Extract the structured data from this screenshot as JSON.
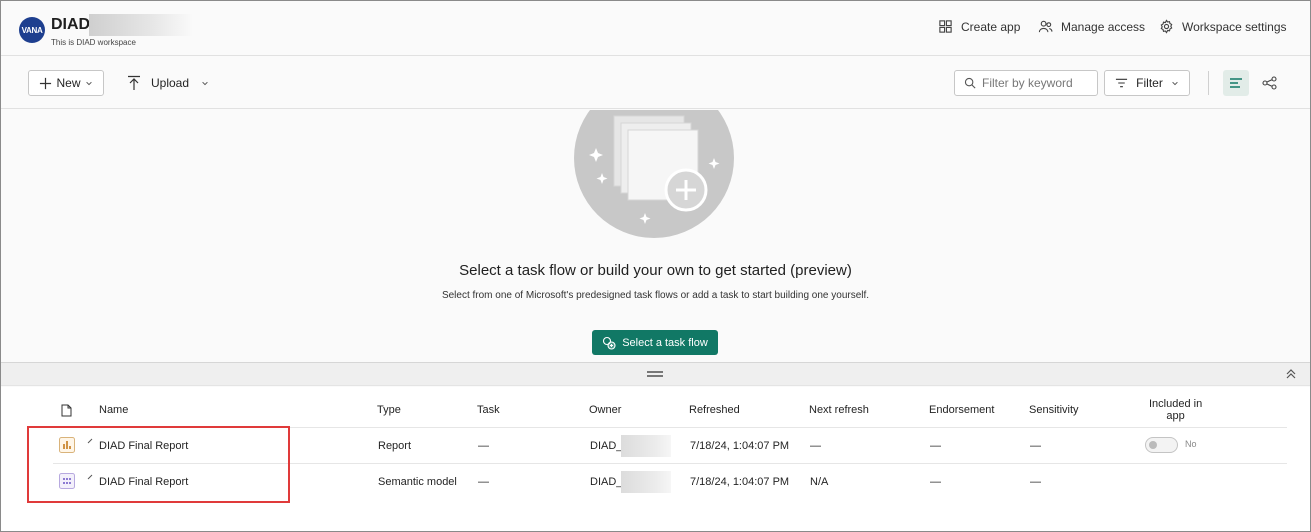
{
  "workspace": {
    "logo_text": "VANA",
    "name": "DIAD_",
    "description": "This is DIAD workspace"
  },
  "header_actions": {
    "create_app": "Create app",
    "manage_access": "Manage access",
    "workspace_settings": "Workspace settings"
  },
  "toolbar": {
    "new_label": "New",
    "upload_label": "Upload",
    "filter_placeholder": "Filter by keyword",
    "filter_label": "Filter"
  },
  "empty_state": {
    "title": "Select a task flow or build your own to get started (preview)",
    "subtitle": "Select from one of Microsoft's predesigned task flows or add a task to start building one yourself.",
    "button_label": "Select a task flow"
  },
  "table": {
    "columns": {
      "name": "Name",
      "type": "Type",
      "task": "Task",
      "owner": "Owner",
      "refreshed": "Refreshed",
      "next_refresh": "Next refresh",
      "endorsement": "Endorsement",
      "sensitivity": "Sensitivity",
      "included_in_app_line1": "Included in",
      "included_in_app_line2": "app"
    },
    "rows": [
      {
        "icon": "report-icon",
        "name": "DIAD Final Report",
        "type": "Report",
        "task": "—",
        "owner": "DIAD_",
        "refreshed": "7/18/24, 1:04:07 PM",
        "next_refresh": "—",
        "endorsement": "—",
        "sensitivity": "—",
        "included_in_app": "No"
      },
      {
        "icon": "semantic-model-icon",
        "name": "DIAD Final Report",
        "type": "Semantic model",
        "task": "—",
        "owner": "DIAD_",
        "refreshed": "7/18/24, 1:04:07 PM",
        "next_refresh": "N/A",
        "endorsement": "—",
        "sensitivity": "—"
      }
    ]
  },
  "colors": {
    "accent": "#117865",
    "highlight": "#e03a3a",
    "logo": "#1e3f8f"
  }
}
